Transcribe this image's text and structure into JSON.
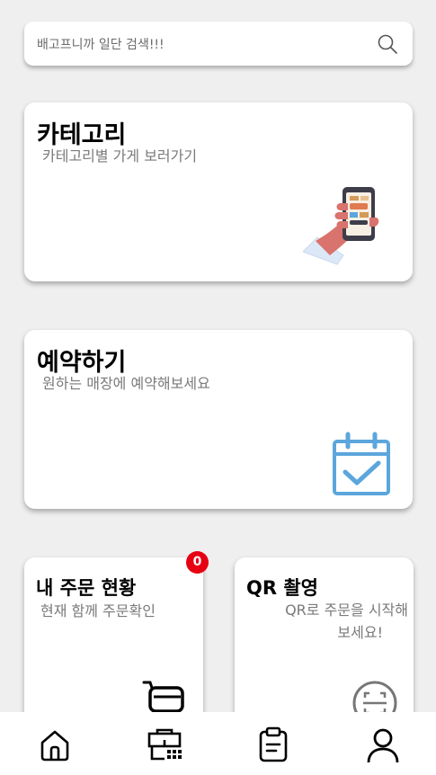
{
  "search": {
    "placeholder": "배고프니까 일단 검색!!!",
    "icon": "search-icon"
  },
  "cards": {
    "category": {
      "title": "카테고리",
      "subtitle": "카테고리별 가게 보러가기",
      "illustration": "phone-in-hand-illustration"
    },
    "reservation": {
      "title": "예약하기",
      "subtitle": "원하는 매장에 예약해보세요",
      "illustration": "calendar-check-icon"
    },
    "orders": {
      "title": "내 주문 현황",
      "subtitle": "현재 함께 주문확인",
      "badge": "0",
      "icon": "cart-icon"
    },
    "qr": {
      "title": "QR 촬영",
      "subtitle_line1": "QR로 주문을 시작해",
      "subtitle_line2": "보세요!",
      "icon": "qr-scan-icon"
    }
  },
  "bottom_nav": {
    "items": [
      {
        "name": "home",
        "icon": "home-icon"
      },
      {
        "name": "store",
        "icon": "store-icon"
      },
      {
        "name": "orders",
        "icon": "clipboard-icon"
      },
      {
        "name": "profile",
        "icon": "user-icon"
      }
    ]
  },
  "colors": {
    "accent": "#5ba6dc",
    "badge": "#e60012",
    "background": "#efefef"
  }
}
